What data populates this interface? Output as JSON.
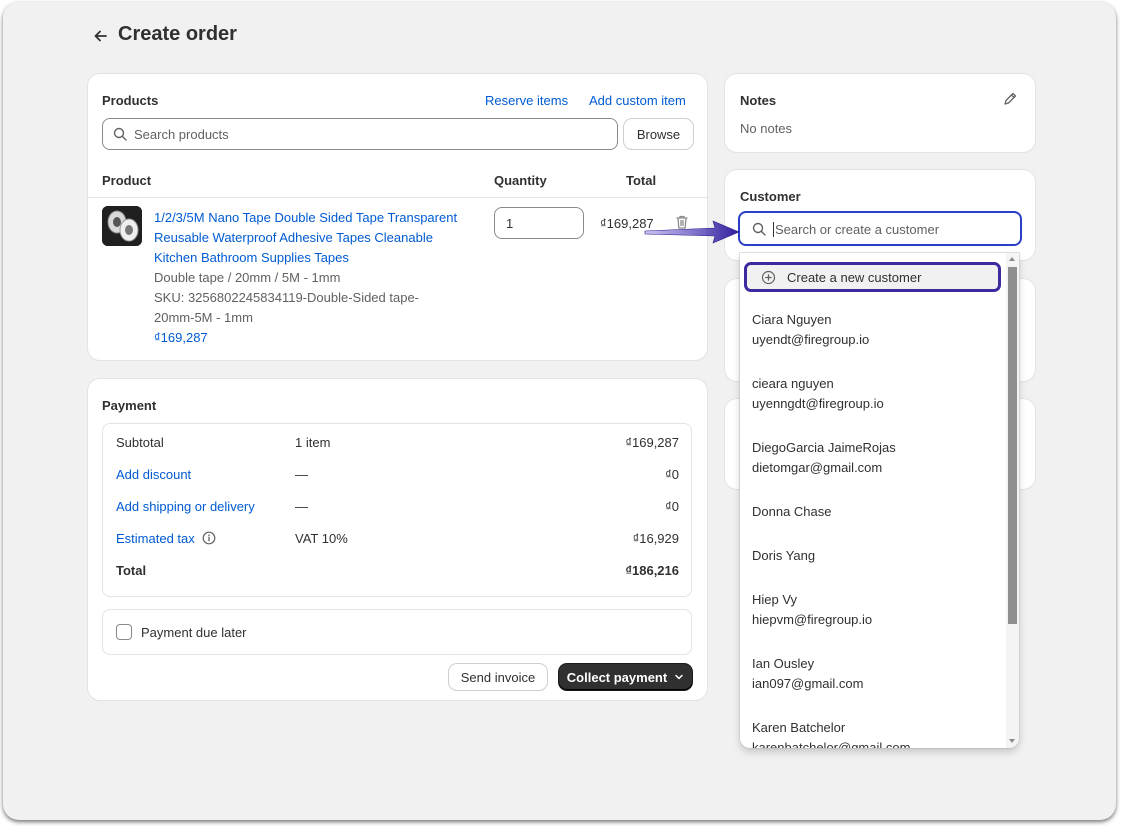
{
  "page": {
    "title": "Create order",
    "back_icon": "arrow-left-icon"
  },
  "products": {
    "heading": "Products",
    "reserve_items": "Reserve items",
    "add_custom_item": "Add custom item",
    "search_placeholder": "Search products",
    "browse_label": "Browse",
    "columns": {
      "product": "Product",
      "quantity": "Quantity",
      "total": "Total"
    },
    "item": {
      "title_lines": [
        "1/2/3/5M Nano Tape Double Sided Tape Transparent",
        "Reusable Waterproof Adhesive Tapes Cleanable",
        "Kitchen Bathroom Supplies Tapes"
      ],
      "variant": "Double tape / 20mm / 5M - 1mm",
      "sku_lines": [
        "SKU: 3256802245834119-Double-Sided tape-",
        "20mm-5M - 1mm"
      ],
      "price": "₫169,287",
      "quantity": "1",
      "total": "₫169,287"
    }
  },
  "payment": {
    "heading": "Payment",
    "subtotal": {
      "label": "Subtotal",
      "detail": "1 item",
      "amount": "₫169,287"
    },
    "discount": {
      "label": "Add discount",
      "detail": "—",
      "amount": "₫0"
    },
    "shipping": {
      "label": "Add shipping or delivery",
      "detail": "—",
      "amount": "₫0"
    },
    "tax": {
      "label": "Estimated tax",
      "detail": "VAT 10%",
      "amount": "₫16,929"
    },
    "total": {
      "label": "Total",
      "amount": "₫186,216"
    },
    "due_later": "Payment due later",
    "send_invoice": "Send invoice",
    "collect_payment": "Collect payment"
  },
  "notes": {
    "heading": "Notes",
    "value": "No notes"
  },
  "customer": {
    "heading": "Customer",
    "search_placeholder": "Search or create a customer",
    "create_new": "Create a new customer",
    "list": [
      {
        "name": "Ciara Nguyen",
        "email": "uyendt@firegroup.io"
      },
      {
        "name": "cieara nguyen",
        "email": "uyenngdt@firegroup.io"
      },
      {
        "name": "DiegoGarcia JaimeRojas",
        "email": "dietomgar@gmail.com"
      },
      {
        "name": "Donna Chase",
        "email": ""
      },
      {
        "name": "Doris Yang",
        "email": ""
      },
      {
        "name": "Hiep Vy",
        "email": "hiepvm@firegroup.io"
      },
      {
        "name": "Ian Ousley",
        "email": "ian097@gmail.com"
      },
      {
        "name": "Karen Batchelor",
        "email": "karenbatchelor@gmail.com"
      }
    ]
  },
  "colors": {
    "link": "#005bd3",
    "highlight": "#3d2a9e",
    "dark_button": "#303030"
  }
}
